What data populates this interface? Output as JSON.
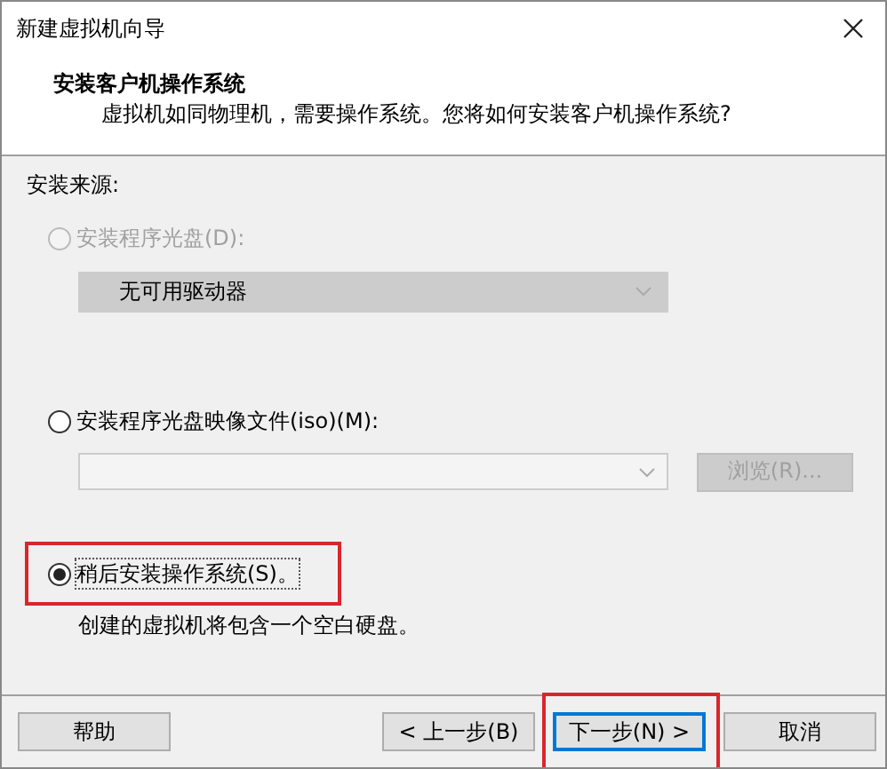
{
  "window": {
    "title": "新建虚拟机向导"
  },
  "header": {
    "title": "安装客户机操作系统",
    "subtitle": "虚拟机如同物理机，需要操作系统。您将如何安装客户机操作系统?"
  },
  "section_label": "安装来源:",
  "options": [
    {
      "kind": "disc",
      "label": "安装程序光盘(D):",
      "selected": false,
      "disabled": true,
      "highlighted": false,
      "dropdown": {
        "value": "无可用驱动器",
        "disabled": true
      }
    },
    {
      "kind": "iso",
      "label": "安装程序光盘映像文件(iso)(M):",
      "selected": false,
      "disabled": false,
      "highlighted": false,
      "browse": {
        "label": "浏览(R)...",
        "disabled": true
      }
    },
    {
      "kind": "later",
      "label": "稍后安装操作系统(S)。",
      "selected": true,
      "disabled": false,
      "highlighted": true,
      "note": "创建的虚拟机将包含一个空白硬盘。"
    }
  ],
  "buttons": [
    {
      "label": "帮助",
      "focused": false,
      "highlighted": false
    },
    {
      "label": "< 上一步(B)",
      "focused": false,
      "highlighted": false
    },
    {
      "label": "下一步(N) >",
      "focused": true,
      "highlighted": true
    },
    {
      "label": "取消",
      "focused": false,
      "highlighted": false
    }
  ]
}
